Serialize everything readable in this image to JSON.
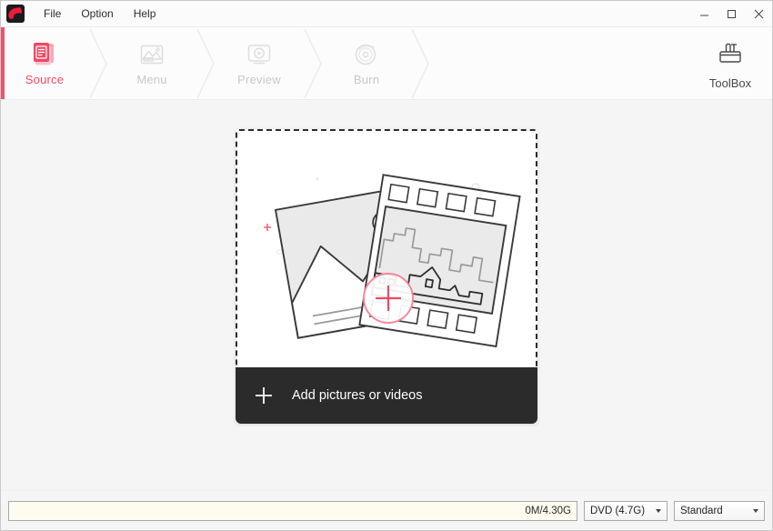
{
  "window": {
    "menu": [
      {
        "label": "File"
      },
      {
        "label": "Option"
      },
      {
        "label": "Help"
      }
    ],
    "controls": {
      "minimize": "–",
      "maximize": "□",
      "close": "✕"
    },
    "app_icon_name": "app-logo-icon"
  },
  "toolbar": {
    "tabs": [
      {
        "label": "Source",
        "icon": "documents-icon",
        "active": true
      },
      {
        "label": "Menu",
        "icon": "picture-icon",
        "active": false
      },
      {
        "label": "Preview",
        "icon": "monitor-play-icon",
        "active": false
      },
      {
        "label": "Burn",
        "icon": "disc-icon",
        "active": false
      }
    ],
    "toolbox": {
      "label": "ToolBox",
      "icon": "toolbox-icon"
    },
    "accent_color": "#ef4963",
    "inactive_color": "#c8c8c8"
  },
  "main": {
    "drop_zone": {
      "illustration": "photos-and-filmstrip-illustration",
      "add_circle_icon": "plus-circle-icon"
    },
    "add_bar": {
      "label": "Add pictures or videos",
      "icon": "plus-icon"
    }
  },
  "bottom": {
    "capacity_text": "0M/4.30G",
    "disc_select": {
      "value": "DVD (4.7G)"
    },
    "quality_select": {
      "value": "Standard"
    }
  },
  "colors": {
    "accent": "#ef4963",
    "accent_soft": "#e8566e",
    "dark_panel": "#2b2b2b",
    "page_bg": "#f5f5f5",
    "capacity_fill": "#fdfcef"
  }
}
